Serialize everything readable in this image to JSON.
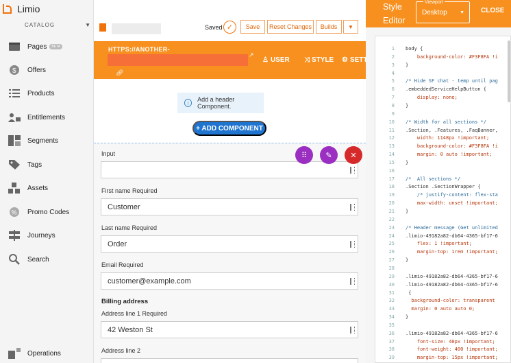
{
  "brand": {
    "name": "Limio"
  },
  "sidebar": {
    "catalog_label": "CATALOG",
    "items": [
      {
        "label": "Pages",
        "badge": "BETA",
        "icon": "pages-icon"
      },
      {
        "label": "Offers",
        "icon": "dollar-icon"
      },
      {
        "label": "Products",
        "icon": "list-icon"
      },
      {
        "label": "Entitlements",
        "icon": "user-lock-icon"
      },
      {
        "label": "Segments",
        "icon": "segments-icon"
      },
      {
        "label": "Tags",
        "icon": "tag-icon"
      },
      {
        "label": "Assets",
        "icon": "boxes-icon"
      },
      {
        "label": "Promo Codes",
        "icon": "percent-icon"
      },
      {
        "label": "Journeys",
        "icon": "signpost-icon"
      },
      {
        "label": "Search",
        "icon": "search-icon"
      },
      {
        "label": "Operations",
        "icon": "operations-icon"
      }
    ]
  },
  "toolbar": {
    "saved_label": "Saved",
    "save_label": "Save",
    "reset_label": "Reset Changes",
    "builds_label": "Builds",
    "more_label": "▼"
  },
  "page_header": {
    "url_text": "HTTPS://ANOTHER-",
    "tabs": [
      {
        "label": "USER",
        "icon": "user-icon"
      },
      {
        "label": "STYLE",
        "icon": "shuffle-icon"
      },
      {
        "label": "SETT",
        "icon": "gear-icon"
      }
    ]
  },
  "canvas": {
    "notice_text": "Add a header Component.",
    "add_component_label": "+ ADD COMPONENT"
  },
  "form": {
    "fields": [
      {
        "label": "Input",
        "value": ""
      },
      {
        "label": "First name Required",
        "value": "Customer"
      },
      {
        "label": "Last name Required",
        "value": "Order"
      },
      {
        "label": "Email Required",
        "value": "customer@example.com"
      }
    ],
    "billing_heading": "Billing address",
    "billing_fields": [
      {
        "label": "Address line 1 Required",
        "value": "42 Weston St"
      },
      {
        "label": "Address line 2",
        "value": ""
      }
    ]
  },
  "style_editor": {
    "title_line1": "Style",
    "title_line2": "Editor",
    "viewport_label": "Viewport",
    "viewport_value": "Desktop",
    "close_label": "CLOSE",
    "code": [
      {
        "n": "1",
        "t": "body {",
        "k": "sel"
      },
      {
        "n": "2",
        "t": "    background-color: #F3F8FA !i",
        "k": "prop"
      },
      {
        "n": "3",
        "t": "}",
        "k": "sel"
      },
      {
        "n": "4",
        "t": "",
        "k": "sel"
      },
      {
        "n": "5",
        "t": "/* Hide SF chat - temp until pag",
        "k": "com"
      },
      {
        "n": "6",
        "t": ".embeddedServiceHelpButton {",
        "k": "sel"
      },
      {
        "n": "7",
        "t": "    display: none;",
        "k": "prop"
      },
      {
        "n": "8",
        "t": "}",
        "k": "sel"
      },
      {
        "n": "9",
        "t": "",
        "k": "sel"
      },
      {
        "n": "10",
        "t": "/* Width for all sections */",
        "k": "com"
      },
      {
        "n": "11",
        "t": ".Section, .Features, .FaqBanner,",
        "k": "sel"
      },
      {
        "n": "12",
        "t": "    width: 1148px !important;",
        "k": "prop"
      },
      {
        "n": "13",
        "t": "    background-color: #F3F8FA !i",
        "k": "prop"
      },
      {
        "n": "14",
        "t": "    margin: 0 auto !important;",
        "k": "prop"
      },
      {
        "n": "15",
        "t": "}",
        "k": "sel"
      },
      {
        "n": "16",
        "t": "",
        "k": "sel"
      },
      {
        "n": "17",
        "t": "/*  All sections */",
        "k": "com"
      },
      {
        "n": "18",
        "t": ".Section .SectionWrapper {",
        "k": "sel"
      },
      {
        "n": "19",
        "t": "    /* justify-content: flex-sta",
        "k": "com"
      },
      {
        "n": "20",
        "t": "    max-width: unset !important;",
        "k": "prop"
      },
      {
        "n": "21",
        "t": "}",
        "k": "sel"
      },
      {
        "n": "22",
        "t": "",
        "k": "sel"
      },
      {
        "n": "23",
        "t": "/* Header message (Get unlimited",
        "k": "com"
      },
      {
        "n": "24",
        "t": ".limio-49182a82-db64-4365-bf17-6",
        "k": "sel"
      },
      {
        "n": "25",
        "t": "    flex: 1 !important;",
        "k": "prop"
      },
      {
        "n": "26",
        "t": "    margin-top: 1rem !important;",
        "k": "prop"
      },
      {
        "n": "27",
        "t": "}",
        "k": "sel"
      },
      {
        "n": "28",
        "t": "",
        "k": "sel"
      },
      {
        "n": "29",
        "t": ".limio-49182a82-db64-4365-bf17-6",
        "k": "sel"
      },
      {
        "n": "30",
        "t": ".limio-49182a82-db64-4365-bf17-6",
        "k": "sel"
      },
      {
        "n": "31",
        "t": " {",
        "k": "sel"
      },
      {
        "n": "32",
        "t": "  background-color: transparent",
        "k": "prop"
      },
      {
        "n": "33",
        "t": "  margin: 0 auto auto 0;",
        "k": "prop"
      },
      {
        "n": "34",
        "t": "}",
        "k": "sel"
      },
      {
        "n": "35",
        "t": "",
        "k": "sel"
      },
      {
        "n": "36",
        "t": ".limio-49182a82-db64-4365-bf17-6",
        "k": "sel"
      },
      {
        "n": "37",
        "t": "    font-size: 40px !important;",
        "k": "prop"
      },
      {
        "n": "38",
        "t": "    font-weight: 400 !important;",
        "k": "prop"
      },
      {
        "n": "39",
        "t": "    margin-top: 15px !important;",
        "k": "prop"
      }
    ]
  }
}
